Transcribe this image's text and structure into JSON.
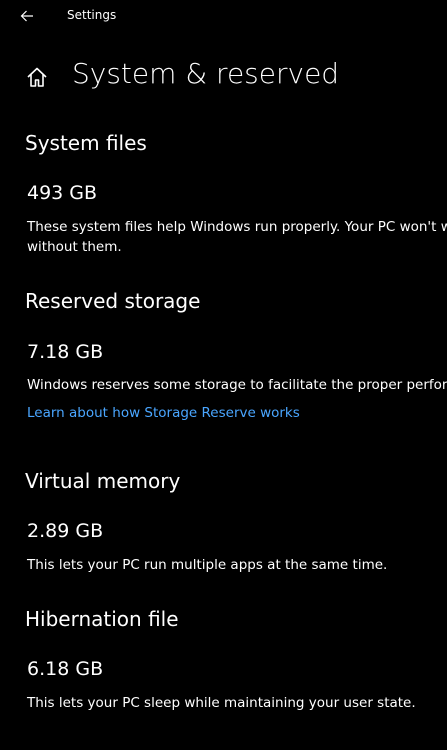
{
  "window": {
    "title": "Settings"
  },
  "icons": {
    "back": "back-arrow-icon",
    "home": "home-icon"
  },
  "page": {
    "title": "System & reserved"
  },
  "sections": {
    "system_files": {
      "heading": "System files",
      "size": "493 GB",
      "description_line1": "These system files help Windows run properly. Your PC won't w",
      "description_line2": "without them."
    },
    "reserved_storage": {
      "heading": "Reserved storage",
      "size": "7.18 GB",
      "description": "Windows reserves some storage to facilitate the proper perform",
      "link": "Learn about how Storage Reserve works"
    },
    "virtual_memory": {
      "heading": "Virtual memory",
      "size": "2.89 GB",
      "description": "This lets your PC run multiple apps at the same time."
    },
    "hibernation_file": {
      "heading": "Hibernation file",
      "size": "6.18 GB",
      "description": "This lets your PC sleep while maintaining your user state."
    }
  },
  "colors": {
    "background": "#000000",
    "text": "#ffffff",
    "link": "#4aa6ff"
  }
}
